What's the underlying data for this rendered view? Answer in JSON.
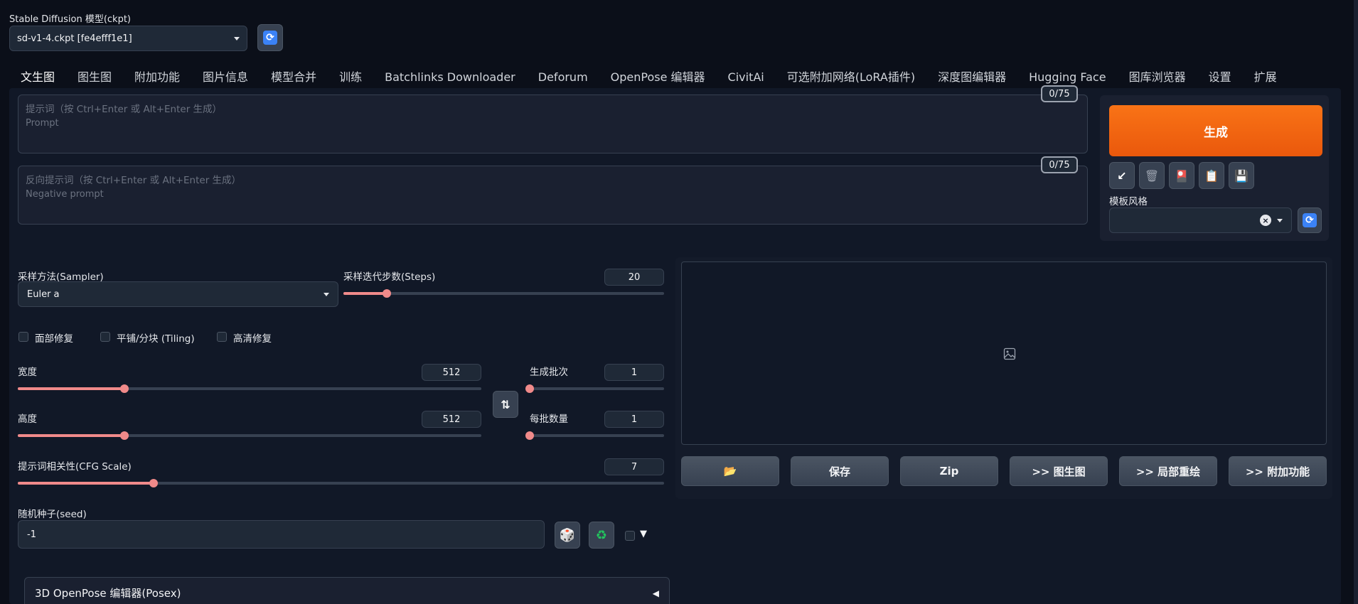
{
  "model": {
    "label": "Stable Diffusion 模型(ckpt)",
    "value": "sd-v1-4.ckpt [fe4efff1e1]"
  },
  "tabs": [
    {
      "label": "文生图",
      "active": true
    },
    {
      "label": "图生图"
    },
    {
      "label": "附加功能"
    },
    {
      "label": "图片信息"
    },
    {
      "label": "模型合并"
    },
    {
      "label": "训练"
    },
    {
      "label": "Batchlinks Downloader"
    },
    {
      "label": "Deforum"
    },
    {
      "label": "OpenPose 编辑器"
    },
    {
      "label": "CivitAi"
    },
    {
      "label": "可选附加网络(LoRA插件)"
    },
    {
      "label": "深度图编辑器"
    },
    {
      "label": "Hugging Face"
    },
    {
      "label": "图库浏览器"
    },
    {
      "label": "设置"
    },
    {
      "label": "扩展"
    }
  ],
  "prompt": {
    "placeholder_line1": "提示词（按 Ctrl+Enter 或 Alt+Enter 生成）",
    "placeholder_line2": "Prompt",
    "token_count": "0/75"
  },
  "negative_prompt": {
    "placeholder_line1": "反向提示词（按 Ctrl+Enter 或 Alt+Enter 生成）",
    "placeholder_line2": "Negative prompt",
    "token_count": "0/75"
  },
  "generate": {
    "label": "生成",
    "style_label": "模板风格"
  },
  "sampler": {
    "label": "采样方法(Sampler)",
    "value": "Euler a"
  },
  "steps": {
    "label": "采样迭代步数(Steps)",
    "value": "20",
    "fraction": 0.135
  },
  "checkboxes": {
    "face_restore": "面部修复",
    "tiling": "平铺/分块 (Tiling)",
    "hires_fix": "高清修复"
  },
  "width": {
    "label": "宽度",
    "value": "512",
    "fraction": 0.23
  },
  "height": {
    "label": "高度",
    "value": "512",
    "fraction": 0.23
  },
  "batch_count": {
    "label": "生成批次",
    "value": "1",
    "fraction": 0.0
  },
  "batch_size": {
    "label": "每批数量",
    "value": "1",
    "fraction": 0.0
  },
  "cfg": {
    "label": "提示词相关性(CFG Scale)",
    "value": "7",
    "fraction": 0.21
  },
  "seed": {
    "label": "随机种子(seed)",
    "value": "-1"
  },
  "output_buttons": {
    "folder": "📂",
    "save": "保存",
    "zip": "Zip",
    "to_img2img": ">> 图生图",
    "to_inpaint": ">> 局部重绘",
    "to_extras": ">> 附加功能"
  },
  "accordion": {
    "label": "3D OpenPose 编辑器(Posex)",
    "arrow": "◀"
  },
  "colors": {
    "accent": "#f97316",
    "slider": "#f08a8a",
    "background": "#0b0f19"
  }
}
